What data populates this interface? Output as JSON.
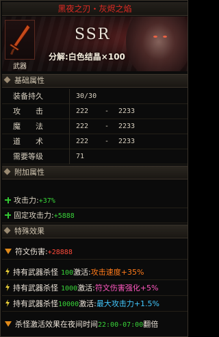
{
  "item": {
    "name": "黑夜之刃・灰烬之焰",
    "slot_label": "武器",
    "rarity": "SSR",
    "decompose": "分解:白色结晶×100"
  },
  "sections": {
    "base": "基础属性",
    "extra": "附加属性",
    "special": "特殊效果"
  },
  "base_stats": {
    "durability": {
      "label": "装备持久",
      "value": "30/30"
    },
    "attack": {
      "label": "攻击",
      "min": "222",
      "dash": "-",
      "max": "2233"
    },
    "magic": {
      "label": "魔法",
      "min": "222",
      "dash": "-",
      "max": "2233"
    },
    "tao": {
      "label": "道术",
      "min": "222",
      "dash": "-",
      "max": "2233"
    },
    "level": {
      "label": "需要等级",
      "value": "71"
    }
  },
  "extra_stats": [
    {
      "label": "攻击力:",
      "value": "+37%"
    },
    {
      "label": "固定攻击力:",
      "value": "+5888"
    }
  ],
  "special": {
    "rune": {
      "label": "符文伤害:",
      "value": "+28888"
    },
    "kills": [
      {
        "label": "持有武器杀怪",
        "count": "100",
        "act": "激活:",
        "effect": "攻击速度+35%",
        "color": "#ff7a1a"
      },
      {
        "label": "持有武器杀怪",
        "count": "1000",
        "act": "激活:",
        "effect": "符文伤害强化+5%",
        "color": "#ff58c0"
      },
      {
        "label": "持有武器杀怪",
        "count": "10000",
        "act": "激活:",
        "effect": "最大攻击力+1.5%",
        "color": "#42c8ff"
      }
    ],
    "night": {
      "prefix": "杀怪激活效果在夜间时间",
      "time": "22:00-07:00",
      "suffix": "翻倍"
    }
  },
  "colors": {
    "accent_red": "#e02a23",
    "green": "#39d439",
    "rarity_frame": "#5a2a20"
  },
  "icons": [
    "sword-icon",
    "plus-icon",
    "triangle-icon",
    "lightning-icon",
    "diamond-icon"
  ]
}
